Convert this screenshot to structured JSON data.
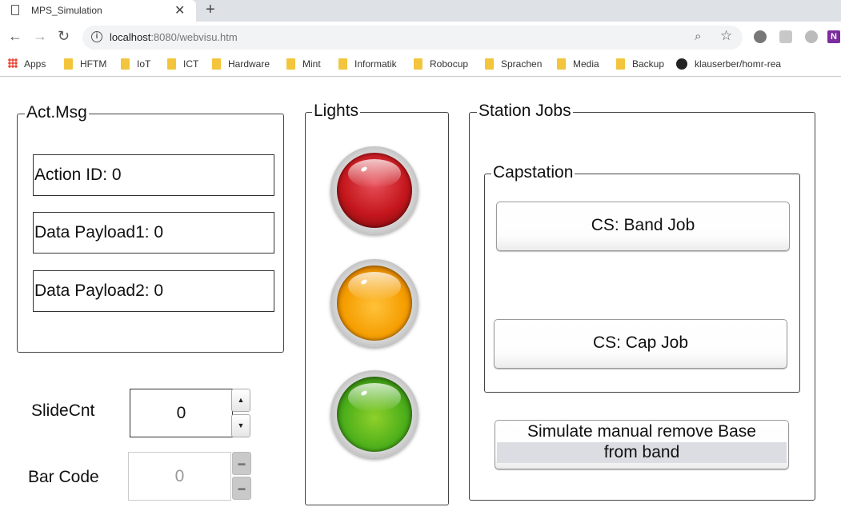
{
  "browser": {
    "tab_title": "MPS_Simulation",
    "tab_close": "✕",
    "new_tab": "+",
    "url_host": "localhost",
    "url_path": ":8080/webvisu.htm",
    "bookmarks": [
      {
        "label": "Apps",
        "icon": "apps-grid-icon"
      },
      {
        "label": "HFTM",
        "icon": "folder-icon"
      },
      {
        "label": "IoT",
        "icon": "folder-icon"
      },
      {
        "label": "ICT",
        "icon": "folder-icon"
      },
      {
        "label": "Hardware",
        "icon": "folder-icon"
      },
      {
        "label": "Mint",
        "icon": "folder-icon"
      },
      {
        "label": "Informatik",
        "icon": "folder-icon"
      },
      {
        "label": "Robocup",
        "icon": "folder-icon"
      },
      {
        "label": "Sprachen",
        "icon": "folder-icon"
      },
      {
        "label": "Media",
        "icon": "folder-icon"
      },
      {
        "label": "Backup",
        "icon": "folder-icon"
      },
      {
        "label": "klauserber/homr-rea",
        "icon": "github-icon"
      }
    ],
    "extension_onenote": "N"
  },
  "act_msg": {
    "legend": "Act.Msg",
    "action_id": "Action ID: 0",
    "payload1": "Data Payload1: 0",
    "payload2": "Data Payload2: 0"
  },
  "lights": {
    "legend": "Lights",
    "colors": {
      "red": "#c4161c",
      "orange": "#f59d00",
      "green": "#4caf1a"
    }
  },
  "slide_cnt": {
    "label": "SlideCnt",
    "value": "0",
    "up": "▲",
    "down": "▼"
  },
  "bar_code": {
    "label": "Bar Code",
    "value": "0"
  },
  "station_jobs": {
    "legend": "Station Jobs",
    "capstation": {
      "legend": "Capstation",
      "band_job": "CS: Band Job",
      "cap_job": "CS: Cap Job"
    },
    "simulate_line1": "Simulate manual remove Base",
    "simulate_line2": "from band"
  }
}
